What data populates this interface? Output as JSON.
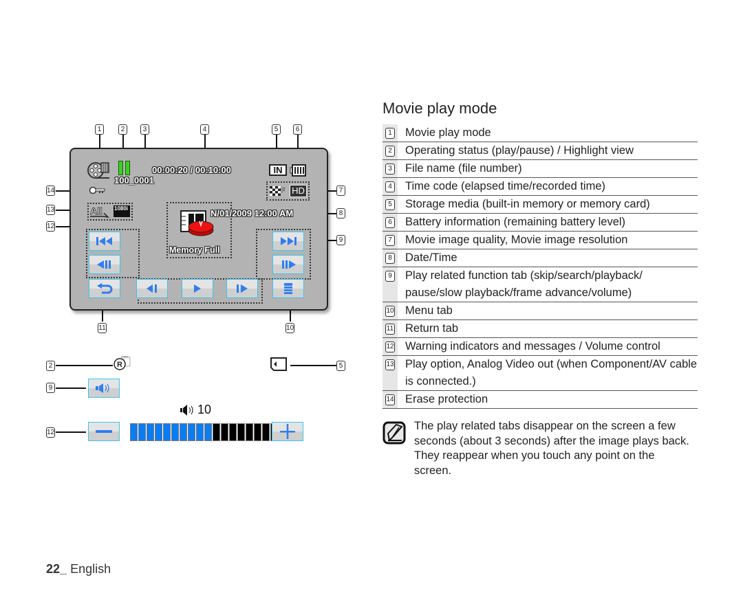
{
  "section_title": "Movie play mode",
  "screen": {
    "time_code": "00:00:20 / 00:10:00",
    "file_name": "100_0001",
    "date_time": "N/01/2009 12:00 AM",
    "warning_message": "Memory Full",
    "storage_label": "IN",
    "quality_label": "F",
    "resolution_label": "HD",
    "analog_out_label": "1080i",
    "play_option_label": "All",
    "buttons": {
      "skip_back": "skip-backward",
      "search_back": "search-backward",
      "return": "return",
      "frame_back": "frame-backward",
      "play": "play",
      "frame_forward": "frame-forward",
      "menu": "menu",
      "skip_forward": "skip-forward",
      "search_forward": "search-forward"
    },
    "accent_color": "#2f7df0",
    "button_border_color": "#39c4f0",
    "panel_color": "#b3b3b3"
  },
  "callouts": {
    "top": [
      "1",
      "2",
      "3",
      "4",
      "5",
      "6"
    ],
    "left": [
      "14",
      "13",
      "12"
    ],
    "right": [
      "7",
      "8",
      "9"
    ],
    "bottom": [
      "11",
      "10"
    ],
    "lower": [
      "2",
      "5",
      "9",
      "12"
    ]
  },
  "volume": {
    "label": "10",
    "level": 10,
    "segments_total": 19,
    "filled_color": "#0a7df5",
    "empty_color": "#000000"
  },
  "items": [
    {
      "num": "1",
      "text": "Movie play mode"
    },
    {
      "num": "2",
      "text": "Operating status (play/pause) / Highlight view"
    },
    {
      "num": "3",
      "text": "File name (file number)"
    },
    {
      "num": "4",
      "text": "Time code (elapsed time/recorded time)"
    },
    {
      "num": "5",
      "text": "Storage media (built-in memory or memory card)"
    },
    {
      "num": "6",
      "text": "Battery information (remaining battery level)"
    },
    {
      "num": "7",
      "text": "Movie image quality, Movie image resolution"
    },
    {
      "num": "8",
      "text": "Date/Time"
    },
    {
      "num": "9",
      "text": "Play related function tab (skip/search/playback/ pause/slow playback/frame advance/volume)"
    },
    {
      "num": "10",
      "text": "Menu tab"
    },
    {
      "num": "11",
      "text": "Return tab"
    },
    {
      "num": "12",
      "text": "Warning indicators and messages / Volume control"
    },
    {
      "num": "13",
      "text": "Play option, Analog Video out (when Component/AV cable is connected.)"
    },
    {
      "num": "14",
      "text": "Erase protection"
    }
  ],
  "note": {
    "icon": "note-pencil-icon",
    "text": "The play related tabs disappear on the screen a few seconds (about 3 seconds) after the image plays back. They reappear when you touch any point on the screen."
  },
  "footer": {
    "page_number": "22_",
    "language": "English"
  }
}
